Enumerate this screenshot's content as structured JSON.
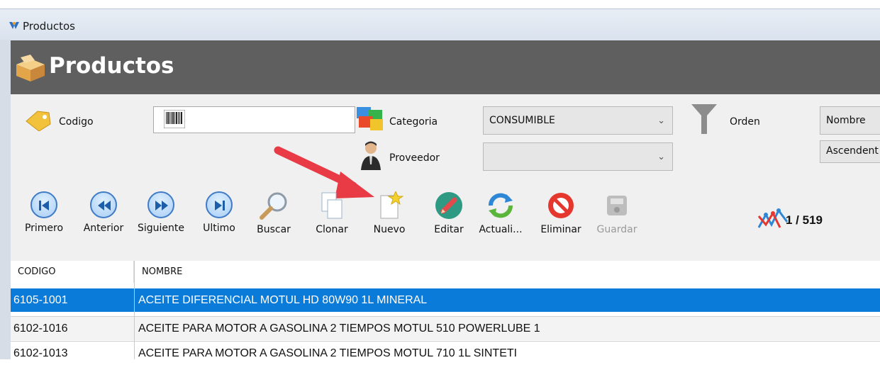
{
  "window": {
    "title": "Productos"
  },
  "header": {
    "title": "Productos"
  },
  "filters": {
    "codigo_label": "Codigo",
    "codigo_value": "",
    "categoria_label": "Categoria",
    "categoria_value": "CONSUMIBLE",
    "proveedor_label": "Proveedor",
    "proveedor_value": "",
    "orden_label": "Orden",
    "orden_value": "Nombre",
    "direccion_value": "Ascendent"
  },
  "toolbar": {
    "primero": "Primero",
    "anterior": "Anterior",
    "siguiente": "Siguiente",
    "ultimo": "Ultimo",
    "buscar": "Buscar",
    "clonar": "Clonar",
    "nuevo": "Nuevo",
    "editar": "Editar",
    "actualizar": "Actuali...",
    "eliminar": "Eliminar",
    "guardar": "Guardar"
  },
  "record_counter": "1 / 519",
  "table": {
    "columns": [
      "CODIGO",
      "NOMBRE"
    ],
    "rows": [
      {
        "codigo": "6105-1001",
        "nombre": "ACEITE DIFERENCIAL MOTUL HD 80W90 1L MINERAL"
      },
      {
        "codigo": "6102-1016",
        "nombre": "ACEITE PARA MOTOR A GASOLINA 2 TIEMPOS MOTUL 510 POWERLUBE 1"
      },
      {
        "codigo": "6102-1013",
        "nombre": "ACEITE PARA MOTOR A GASOLINA 2 TIEMPOS MOTUL 710  1L SINTETI"
      }
    ]
  },
  "colors": {
    "header_bg": "#5f5f5f",
    "selection": "#0b7bd9",
    "arrow": "#e83b45",
    "nav_blue": "#3f7bc6"
  }
}
